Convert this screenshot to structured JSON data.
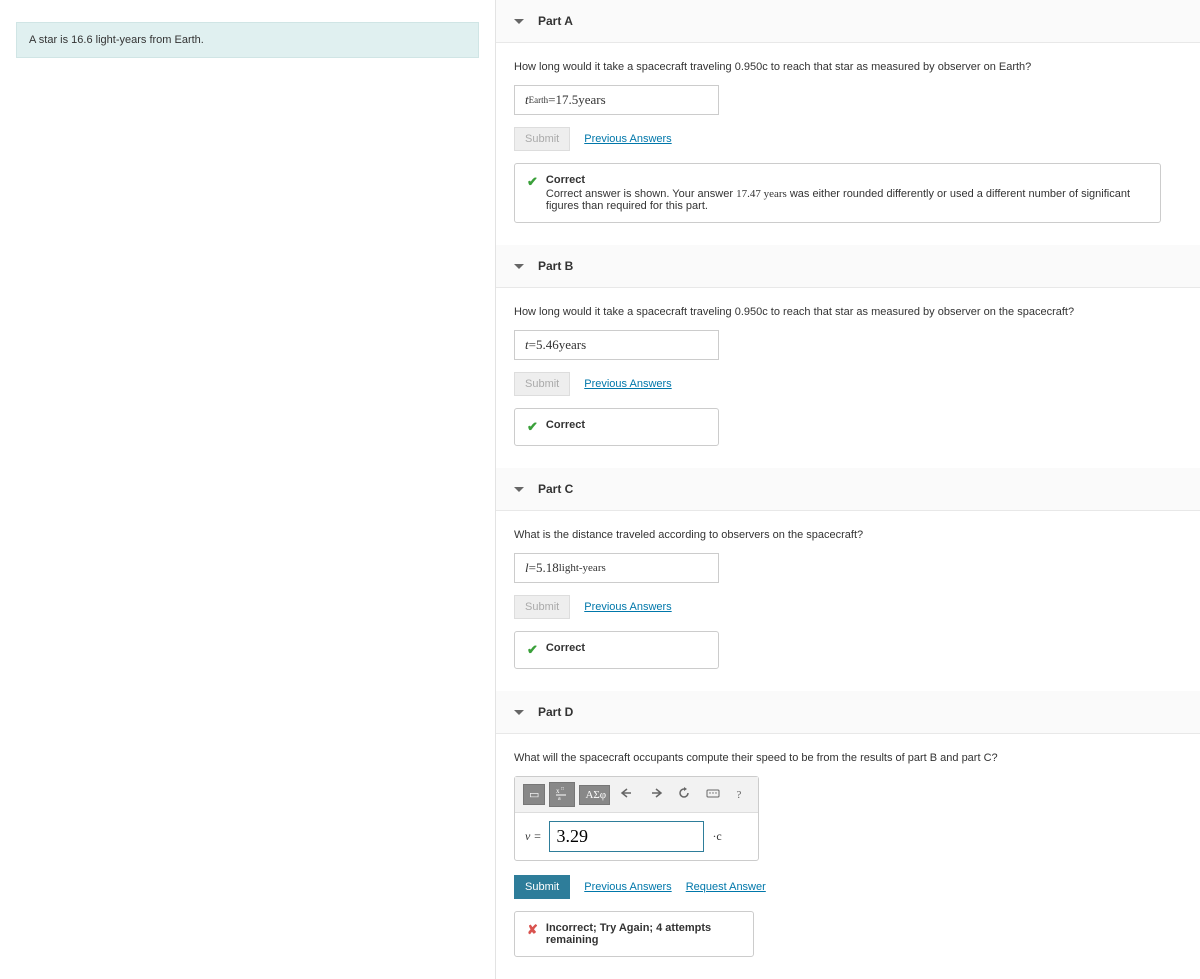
{
  "problem": {
    "text": "A star is 16.6 light-years from Earth."
  },
  "parts": {
    "a": {
      "title": "Part A",
      "question": "How long would it take a spacecraft traveling 0.950c to reach that star as measured by observer on Earth?",
      "var": "t",
      "subscript": "Earth",
      "eq": " = ",
      "value": "17.5",
      "unit": " years",
      "submit": "Submit",
      "prev": "Previous Answers",
      "feedback_title": "Correct",
      "feedback_body_1": "Correct answer is shown. Your answer ",
      "feedback_body_value": "17.47 years",
      "feedback_body_2": " was either rounded differently or used a different number of significant figures than required for this part."
    },
    "b": {
      "title": "Part B",
      "question": "How long would it take a spacecraft traveling 0.950c to reach that star as measured by observer on the spacecraft?",
      "var": "t",
      "eq": " = ",
      "value": "5.46",
      "unit": " years",
      "submit": "Submit",
      "prev": "Previous Answers",
      "feedback_title": "Correct"
    },
    "c": {
      "title": "Part C",
      "question": "What is the distance traveled according to observers on the spacecraft?",
      "var": "l",
      "eq": " = ",
      "value": "5.18",
      "unit": " light-years",
      "submit": "Submit",
      "prev": "Previous Answers",
      "feedback_title": "Correct"
    },
    "d": {
      "title": "Part D",
      "question": "What will the spacecraft occupants compute their speed to be from the results of part B and part C?",
      "toolbar": {
        "rect": "▭",
        "frac": "xª",
        "greek": "ΑΣφ",
        "help": "?"
      },
      "vlabel": "v = ",
      "value": "3.29",
      "unit": "·c",
      "submit": "Submit",
      "prev": "Previous Answers",
      "request": "Request Answer",
      "feedback_title": "Incorrect; Try Again; 4 attempts remaining"
    }
  }
}
